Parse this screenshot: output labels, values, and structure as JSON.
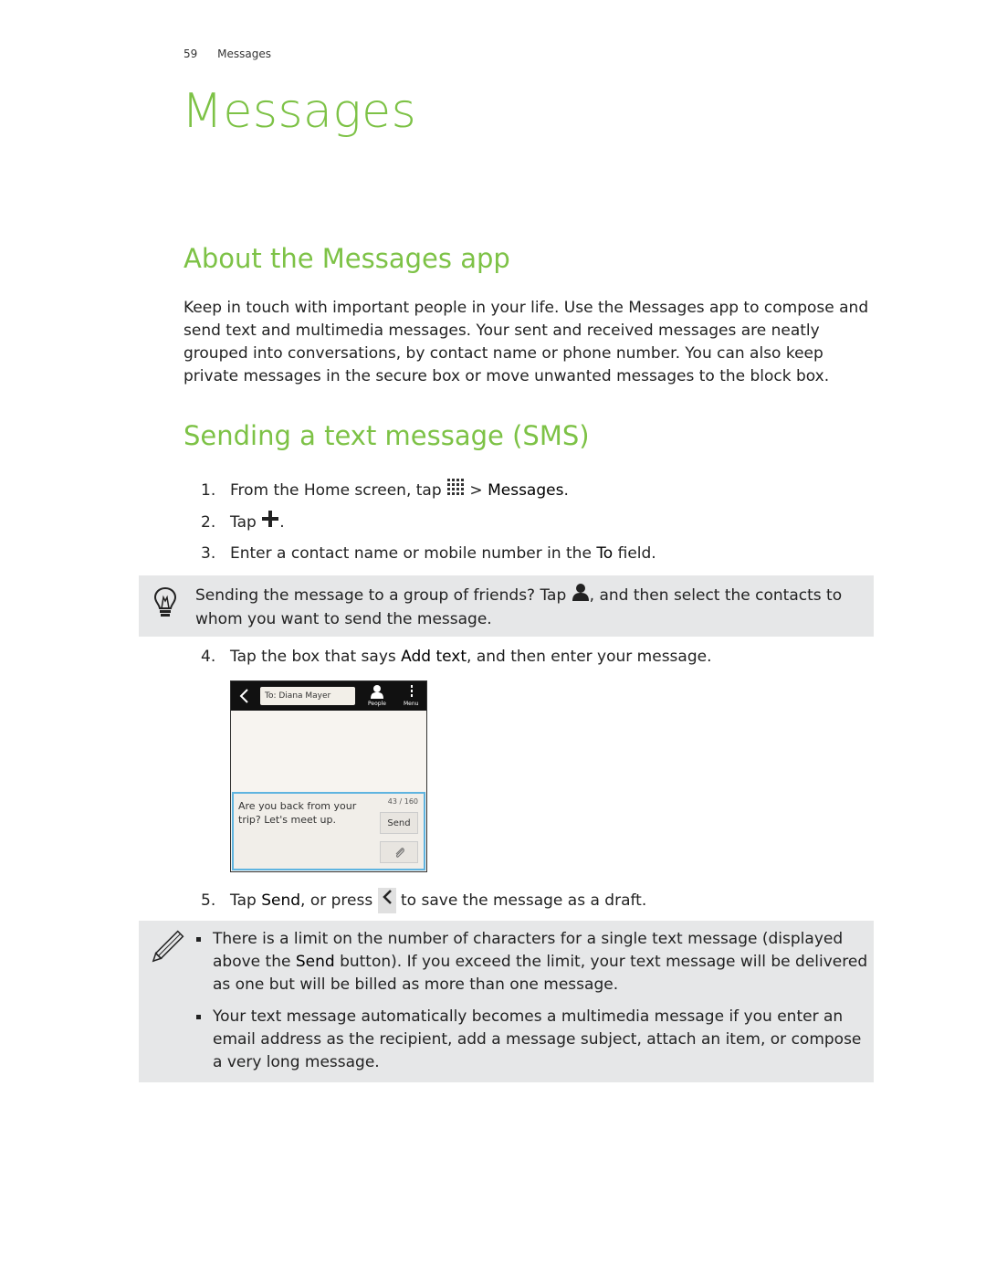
{
  "running_head": {
    "page_number": "59",
    "section": "Messages"
  },
  "chapter_title": "Messages",
  "colors": {
    "heading_green": "#7dc246",
    "note_bg": "#e6e7e8",
    "compose_border": "#5fb4e0"
  },
  "about": {
    "heading": "About the Messages app",
    "body": "Keep in touch with important people in your life. Use the Messages app to compose and send text and multimedia messages. Your sent and received messages are neatly grouped into conversations, by contact name or phone number. You can also keep private messages in the secure box or move unwanted messages to the block box."
  },
  "sending": {
    "heading": "Sending a text message (SMS)",
    "steps": [
      {
        "num": "1.",
        "pre": "From the Home screen, tap ",
        "icon": "app-grid-icon",
        "mid": " > ",
        "ui": "Messages",
        "post": "."
      },
      {
        "num": "2.",
        "pre": "Tap ",
        "icon": "plus-icon",
        "post": "."
      },
      {
        "num": "3.",
        "pre": "Enter a contact name or mobile number in the ",
        "ui": "To",
        "post": " field."
      },
      {
        "num": "4.",
        "pre": "Tap the box that says ",
        "ui": "Add text",
        "post": ", and then enter your message."
      },
      {
        "num": "5.",
        "pre": "Tap ",
        "ui": "Send",
        "mid": ", or press ",
        "icon": "back-icon",
        "post": " to save the message as a draft."
      }
    ],
    "tip": {
      "icon": "lightbulb-icon",
      "pre": "Sending the message to a group of friends? Tap ",
      "icon_inline": "person-icon",
      "post": ", and then select the contacts to whom you want to send the message."
    },
    "screenshot": {
      "to_field": "To: Diana Mayer",
      "people_label": "People",
      "menu_label": "Menu",
      "message_text": "Are you back from your trip? Let's meet up.",
      "char_count": "43 / 160",
      "send_label": "Send"
    },
    "note": {
      "icon": "pencil-icon",
      "bullets": [
        {
          "pre": "There is a limit on the number of characters for a single text message (displayed above the ",
          "ui": "Send",
          "post": " button). If you exceed the limit, your text message will be delivered as one but will be billed as more than one message."
        },
        {
          "text": "Your text message automatically becomes a multimedia message if you enter an email address as the recipient, add a message subject, attach an item, or compose a very long message."
        }
      ]
    }
  }
}
